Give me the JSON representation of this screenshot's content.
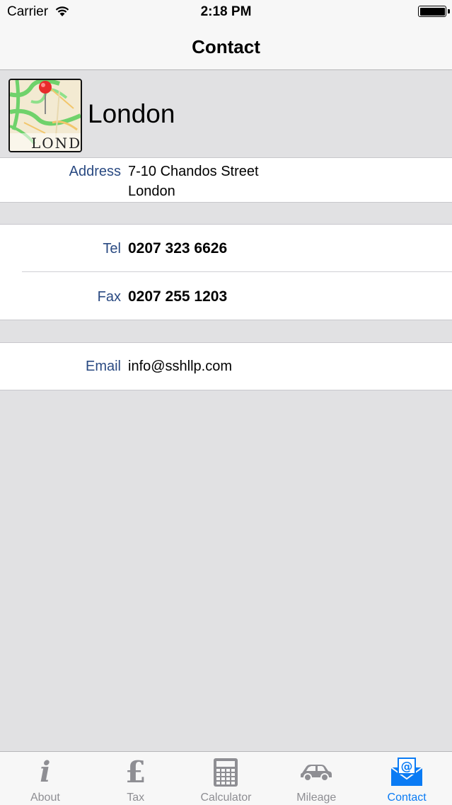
{
  "status_bar": {
    "carrier": "Carrier",
    "time": "2:18 PM"
  },
  "nav": {
    "title": "Contact"
  },
  "office": {
    "name": "London",
    "map_label": "LONDO"
  },
  "address": {
    "label": "Address",
    "line1": "7-10 Chandos Street",
    "line2": "London"
  },
  "phone": {
    "tel_label": "Tel",
    "tel_value": "0207 323 6626",
    "fax_label": "Fax",
    "fax_value": "0207 255 1203"
  },
  "email": {
    "label": "Email",
    "value": "info@sshllp.com"
  },
  "tabs": [
    {
      "label": "About",
      "icon": "info-icon",
      "active": false
    },
    {
      "label": "Tax",
      "icon": "pound-icon",
      "active": false
    },
    {
      "label": "Calculator",
      "icon": "calculator-icon",
      "active": false
    },
    {
      "label": "Mileage",
      "icon": "car-icon",
      "active": false
    },
    {
      "label": "Contact",
      "icon": "email-icon",
      "active": true
    }
  ],
  "colors": {
    "label_blue": "#2a4a82",
    "tab_active": "#0a7bf4",
    "tab_inactive": "#8e8e93"
  }
}
